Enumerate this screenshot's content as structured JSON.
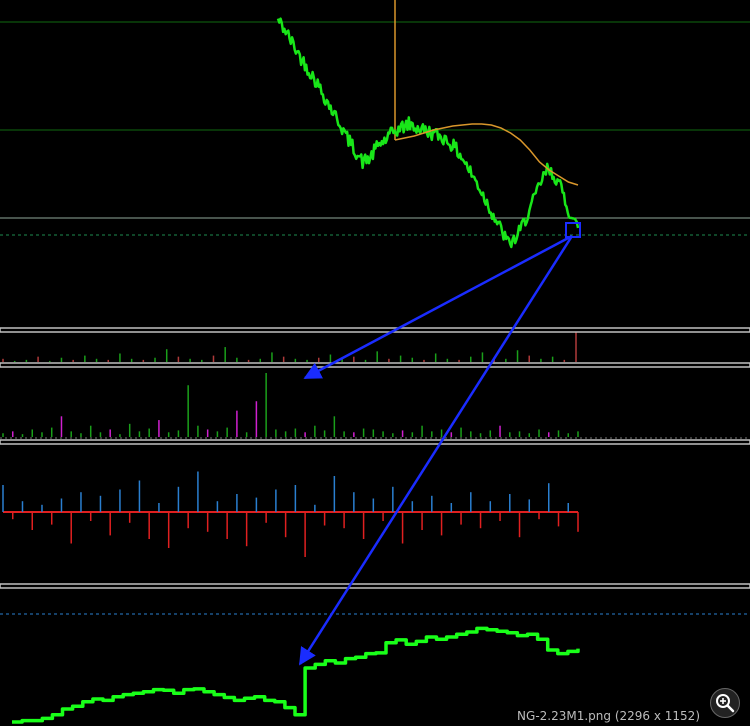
{
  "caption": "NG-2.23M1.png (2296 x 1152)",
  "colors": {
    "price": "#19e619",
    "moving_average": "#d9962b",
    "h_level": "#0f6a0f",
    "h_level_bright": "#8fa89a",
    "dashed_level": "#1e8c50",
    "separator": "#c0c0c0",
    "arrow": "#1a2cff",
    "vol_up": "#1aa01a",
    "vol_down": "#b03a3a",
    "vol_magenta": "#d020d0",
    "delta_pos": "#2a7fd0",
    "delta_neg": "#e02020",
    "cumulative": "#19ff19"
  },
  "icons": {
    "zoom": "zoom-in-icon"
  },
  "chart_data": [
    {
      "type": "line",
      "series": [
        {
          "values": [
            -20,
            -31,
            -45,
            -58,
            -70,
            -82,
            -96,
            -110,
            -123,
            -138,
            -150,
            -162,
            -158,
            -145,
            -140,
            -132,
            -128,
            -124,
            -128,
            -130,
            -133,
            -136,
            -140,
            -148,
            -158,
            -172,
            -185,
            -200,
            -215,
            -230,
            -244,
            -238,
            -222,
            -205,
            -185,
            -170,
            -176,
            -192,
            -215,
            -228
          ]
        },
        {
          "values": [
            -140,
            -138,
            -136,
            -133,
            -130,
            -128,
            -126,
            -125,
            -124,
            -124,
            -125,
            -128,
            -133,
            -140,
            -150,
            -162,
            -170,
            -176,
            -182,
            -185
          ]
        }
      ],
      "h_levels": [
        -22,
        -130,
        -218
      ],
      "dashed_level": -235,
      "annotations": [
        "box",
        "arrow",
        "arrow"
      ]
    },
    {
      "type": "bar",
      "values": [
        3,
        1,
        2,
        5,
        1,
        4,
        2,
        6,
        3,
        2,
        8,
        3,
        2,
        4,
        12,
        5,
        3,
        2,
        6,
        14,
        4,
        2,
        3,
        9,
        5,
        3,
        2,
        4,
        7,
        3,
        5,
        2,
        10,
        3,
        6,
        4,
        2,
        8,
        3,
        2,
        5,
        9,
        4,
        3,
        11,
        6,
        3,
        5,
        2,
        30
      ]
    },
    {
      "type": "bar",
      "values": [
        4,
        6,
        3,
        8,
        5,
        10,
        22,
        6,
        4,
        12,
        5,
        8,
        3,
        14,
        6,
        9,
        18,
        5,
        7,
        55,
        12,
        8,
        6,
        10,
        28,
        5,
        38,
        68,
        8,
        6,
        9,
        5,
        12,
        7,
        22,
        6,
        5,
        9,
        8,
        6,
        4,
        7,
        5,
        12,
        6,
        8,
        5,
        10,
        6,
        4,
        7,
        12,
        5,
        6,
        4,
        8,
        5,
        7,
        4,
        6
      ]
    },
    {
      "type": "bar",
      "values": [
        30,
        -8,
        12,
        -20,
        8,
        -14,
        15,
        -35,
        22,
        -10,
        18,
        -26,
        25,
        -12,
        35,
        -30,
        10,
        -40,
        28,
        -18,
        45,
        -22,
        12,
        -30,
        20,
        -38,
        16,
        -12,
        25,
        -28,
        30,
        -50,
        8,
        -15,
        40,
        -18,
        22,
        -30,
        15,
        -10,
        28,
        -35,
        12,
        -20,
        18,
        -26,
        10,
        -14,
        22,
        -18,
        12,
        -10,
        20,
        -28,
        14,
        -8,
        32,
        -16,
        10,
        -22
      ]
    },
    {
      "type": "line",
      "series": [
        {
          "values": [
            0,
            2,
            2,
            5,
            10,
            18,
            22,
            28,
            32,
            30,
            35,
            38,
            40,
            42,
            45,
            44,
            40,
            45,
            46,
            42,
            38,
            34,
            30,
            33,
            35,
            30,
            28,
            20,
            10,
            75,
            80,
            85,
            82,
            88,
            90,
            95,
            96,
            110,
            114,
            108,
            112,
            118,
            115,
            118,
            122,
            125,
            130,
            128,
            126,
            124,
            120,
            122,
            115,
            100,
            95,
            98,
            102
          ]
        }
      ]
    }
  ]
}
